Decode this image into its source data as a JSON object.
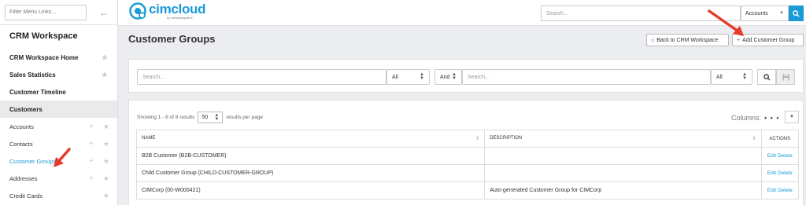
{
  "sidebar": {
    "filter_placeholder": "Filter Menu Links...",
    "back_icon": "arrow-left-icon",
    "title": "CRM Workspace",
    "main_items": [
      {
        "label": "CRM Workspace Home"
      },
      {
        "label": "Sales Statistics"
      },
      {
        "label": "Customer Timeline"
      },
      {
        "label": "Customers"
      }
    ],
    "sub_items": [
      {
        "label": "Accounts"
      },
      {
        "label": "Contacts"
      },
      {
        "label": "Customer Groups"
      },
      {
        "label": "Addresses"
      },
      {
        "label": "Credit Cards"
      }
    ]
  },
  "topbar": {
    "logo_text": "cimcloud",
    "logo_sub": "by websitepipeline",
    "search_placeholder": "Search...",
    "search_scope": "Accounts"
  },
  "page": {
    "title": "Customer Groups",
    "back_button": "Back to CRM Workspace",
    "add_button": "Add Customer Group"
  },
  "search_panel": {
    "search1_placeholder": "Search...",
    "select1_value": "All",
    "join_value": "And",
    "search2_placeholder": "Search...",
    "select2_value": "All"
  },
  "results": {
    "showing_text": "Showing 1 - 8 of 8 results",
    "per_page_value": "50",
    "per_page_suffix": "results per page",
    "columns_label": "Columns:",
    "headers": {
      "name": "NAME",
      "description": "DESCRIPTION",
      "actions": "ACTIONS"
    },
    "edit_label": "Edit",
    "delete_label": "Delete",
    "rows": [
      {
        "name": "B2B Customer (B2B-CUSTOMER)",
        "description": ""
      },
      {
        "name": "Child Customer Group (CHILD-CUSTOMER-GROUP)",
        "description": ""
      },
      {
        "name": "CIMCorp (00-W000421)",
        "description": "Auto-generated Customer Group for CIMCorp"
      }
    ]
  },
  "colors": {
    "accent": "#1a9bd7",
    "annotation_arrow": "#e53b2f"
  }
}
